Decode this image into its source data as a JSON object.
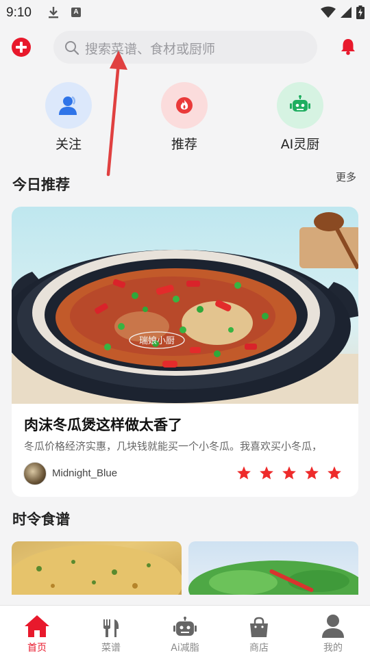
{
  "status_bar": {
    "time": "9:10",
    "notification_letter": "A"
  },
  "header": {
    "search_placeholder": "搜索菜谱、食材或厨师"
  },
  "quick_entries": [
    {
      "label": "关注",
      "icon": "user-group-icon",
      "color": "#dce8fb"
    },
    {
      "label": "推荐",
      "icon": "flame-icon",
      "color": "#fbdcdc"
    },
    {
      "label": "AI灵厨",
      "icon": "robot-icon",
      "color": "#d6f3e2"
    }
  ],
  "today": {
    "title": "今日推荐",
    "more": "更多",
    "card": {
      "image_watermark": "瑞娘小厨",
      "title": "肉沫冬瓜煲这样做太香了",
      "description": "冬瓜价格经济实惠，几块钱就能买一个小冬瓜。我喜欢买小冬瓜，",
      "author": "Midnight_Blue",
      "rating": 5
    }
  },
  "seasonal": {
    "title": "时令食谱"
  },
  "bottom_nav": [
    {
      "label": "首页",
      "icon": "home-icon",
      "active": true
    },
    {
      "label": "菜谱",
      "icon": "fork-knife-icon",
      "active": false
    },
    {
      "label": "Ai减脂",
      "icon": "robot-icon",
      "active": false
    },
    {
      "label": "商店",
      "icon": "shopping-bag-icon",
      "active": false
    },
    {
      "label": "我的",
      "icon": "profile-icon",
      "active": false
    }
  ],
  "colors": {
    "accent": "#e8192c",
    "background": "#f4f4f5",
    "star": "#ee2b2b"
  }
}
